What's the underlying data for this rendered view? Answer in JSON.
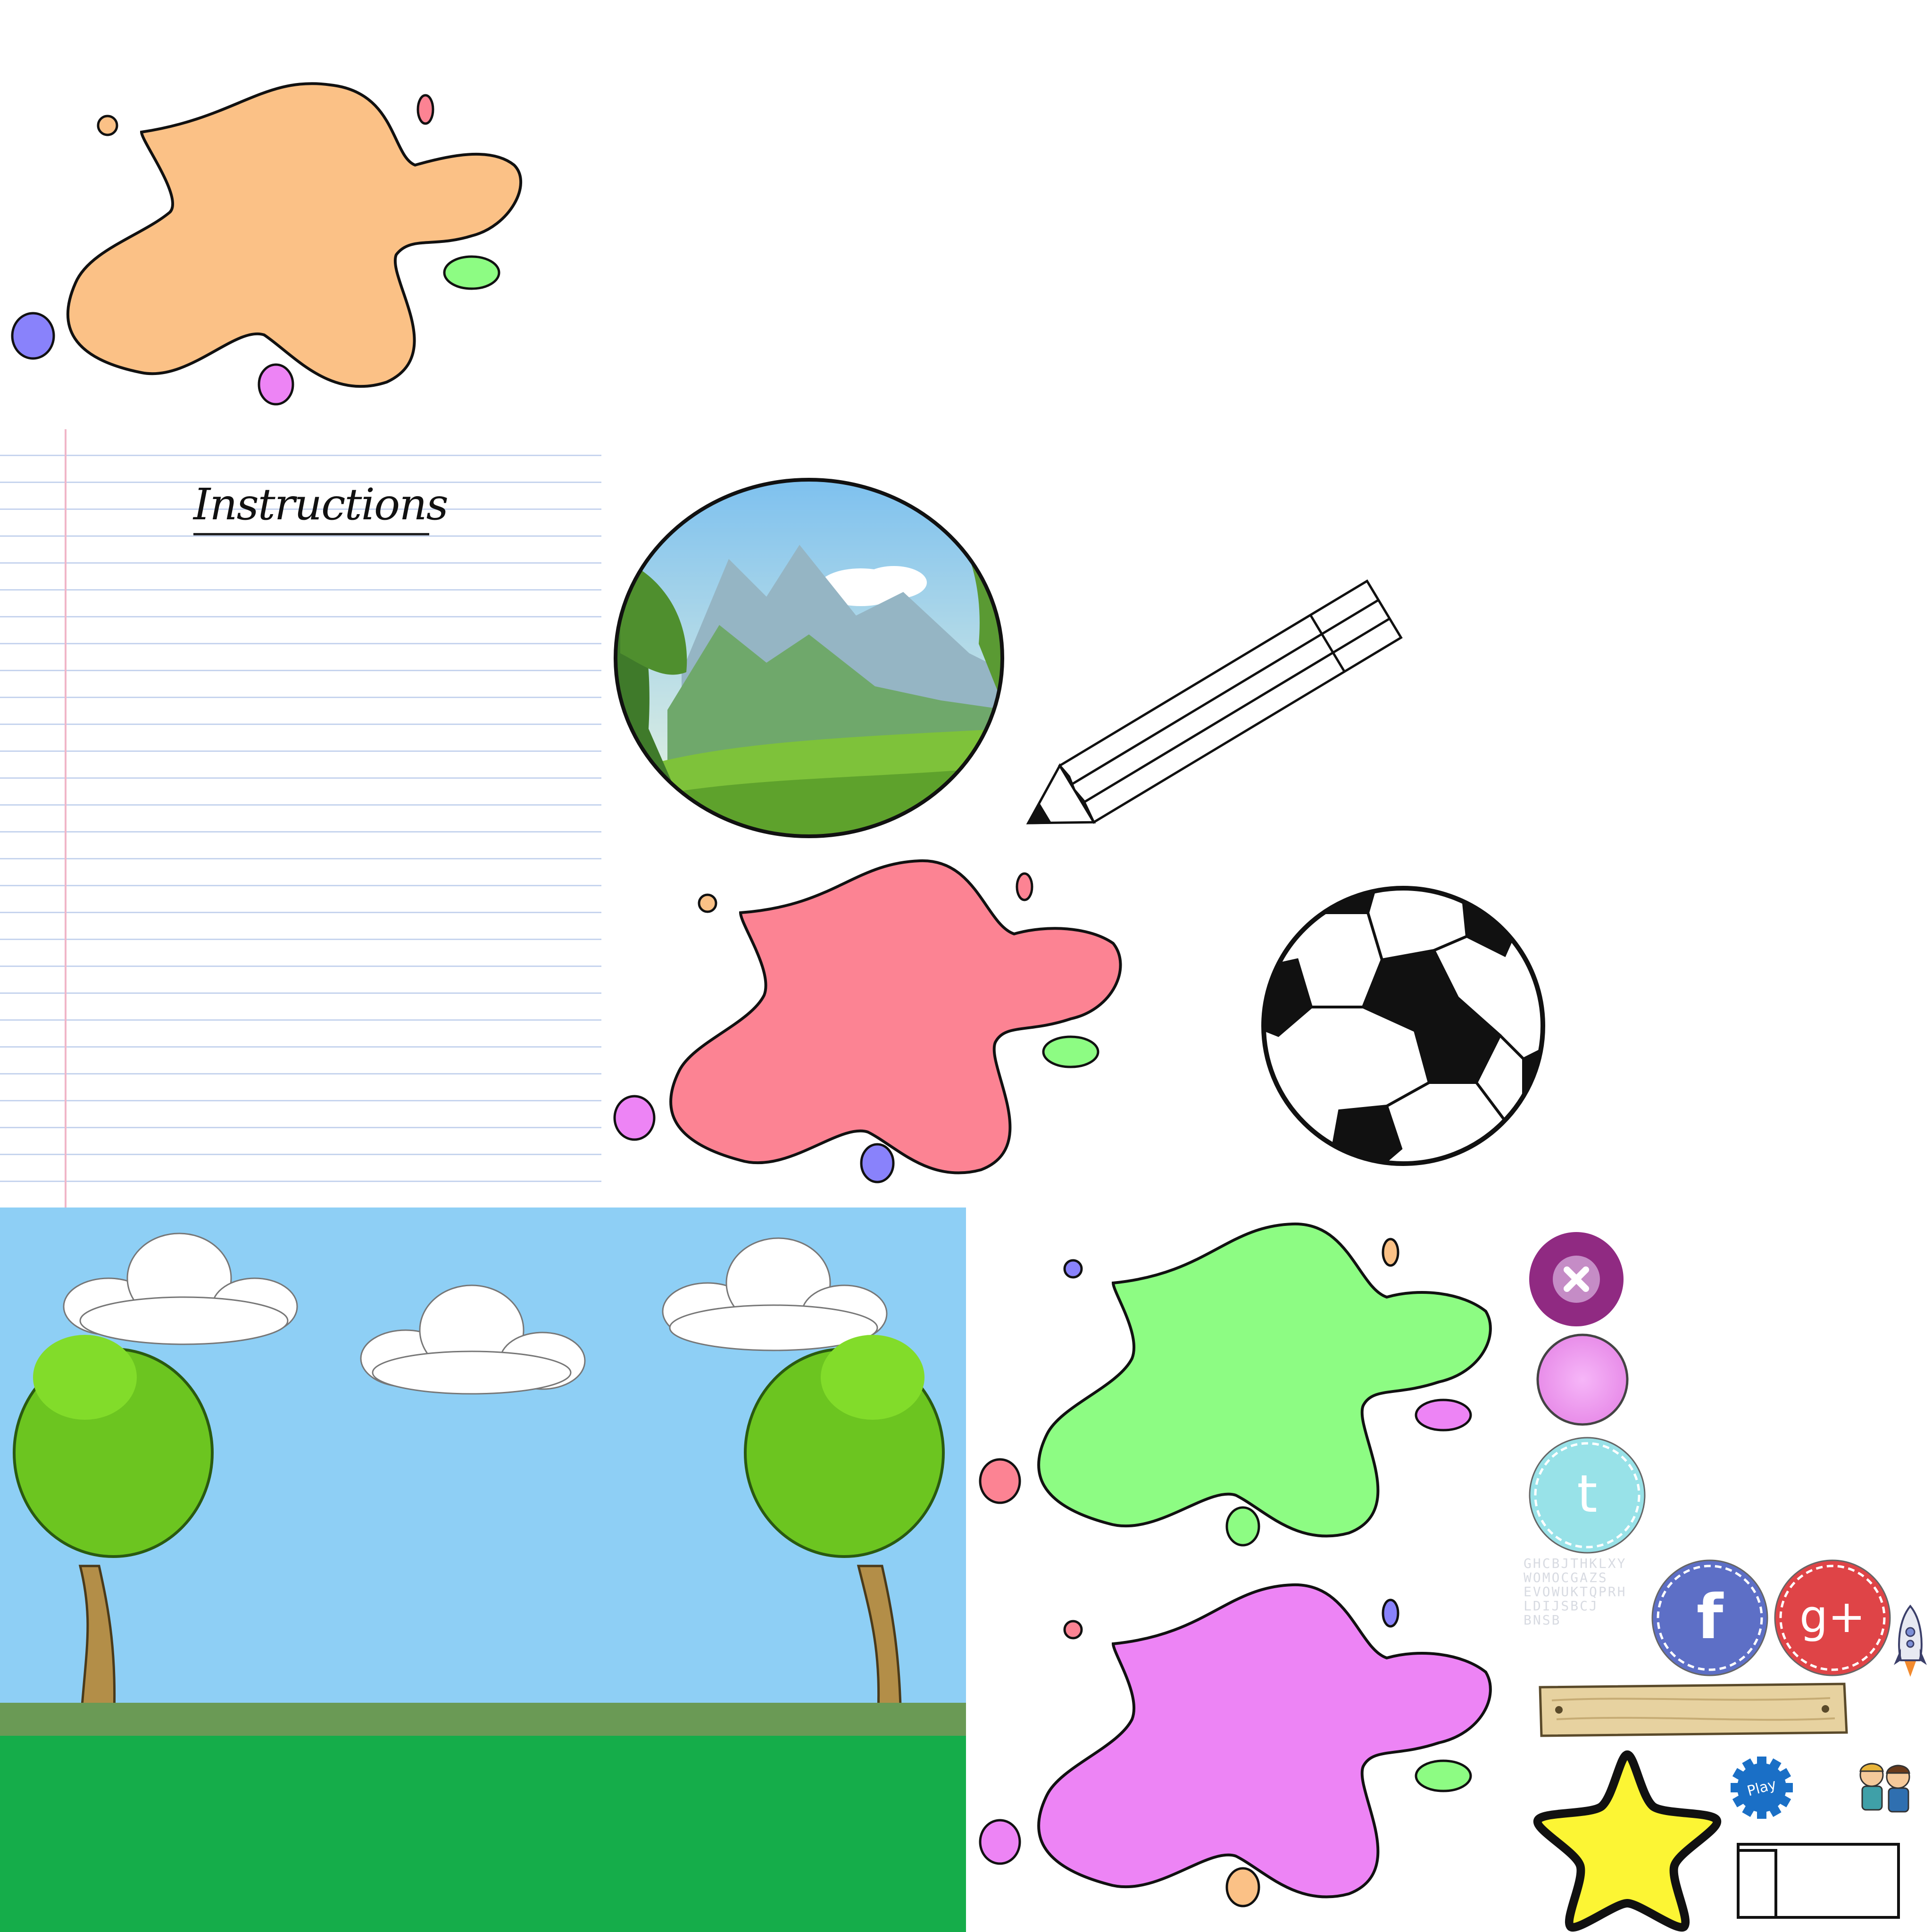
{
  "sprite_sheet": {
    "instructions_page": {
      "title": "Instructions",
      "paper_color": "#ffffff",
      "rule_color": "#c6d4ee",
      "margin_color": "#f0b6c8"
    },
    "splats": [
      {
        "name": "orange-splat",
        "color": "#fbc186"
      },
      {
        "name": "pink-splat",
        "color": "#fc8393"
      },
      {
        "name": "green-splat",
        "color": "#8dfc83"
      },
      {
        "name": "magenta-splat",
        "color": "#ed84f5"
      }
    ],
    "buttons": {
      "close_icon": "close-icon",
      "tumblr_letter": "t",
      "facebook_letter": "f",
      "google_plus_label": "g+",
      "play_label": "Play"
    },
    "colors": {
      "sky": "#8ecff5",
      "grass": "#15ad4a",
      "star": "#fcf534",
      "close_button": "#902a82",
      "facebook": "#5d6fc6",
      "google_plus": "#df4447",
      "tumblr": "#98e2e8",
      "play_gear": "#1a6fc6",
      "plank": "#e7d2a0"
    },
    "logo_letter_rows": [
      "GHCBJTHKLXY",
      "WOMOCGAZS",
      "EVOWUKTQPRH",
      "LDIJSBCJ",
      "BNSB"
    ]
  }
}
